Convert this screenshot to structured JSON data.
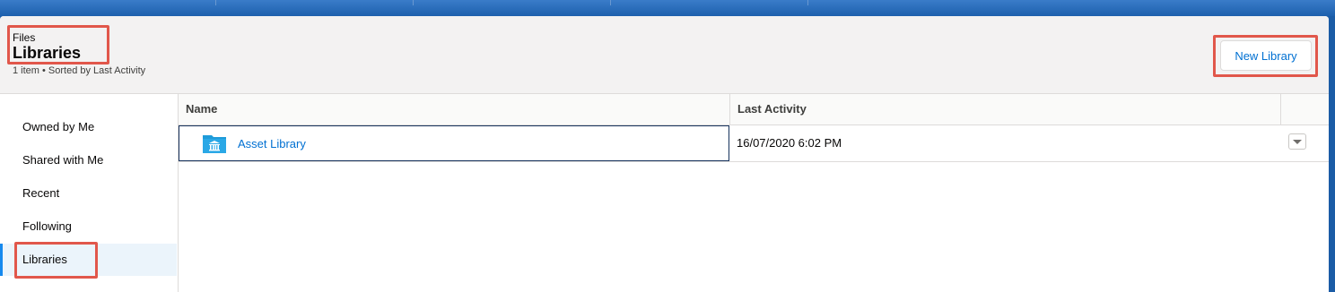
{
  "header": {
    "object_label": "Files",
    "title": "Libraries",
    "subtitle": "1 item • Sorted by Last Activity",
    "new_button_label": "New Library"
  },
  "sidebar": {
    "items": [
      {
        "label": "Owned by Me"
      },
      {
        "label": "Shared with Me"
      },
      {
        "label": "Recent"
      },
      {
        "label": "Following"
      },
      {
        "label": "Libraries",
        "active": true
      }
    ]
  },
  "table": {
    "columns": [
      "Name",
      "Last Activity"
    ],
    "rows": [
      {
        "name": "Asset Library",
        "last_activity": "16/07/2020 6:02 PM",
        "icon": "library-icon"
      }
    ]
  },
  "colors": {
    "accent": "#0070d2",
    "highlight": "#e1574b",
    "banner": "#1d60ad",
    "active_nav": "#ebf4fb",
    "library_icon": "#1e9bd9"
  }
}
